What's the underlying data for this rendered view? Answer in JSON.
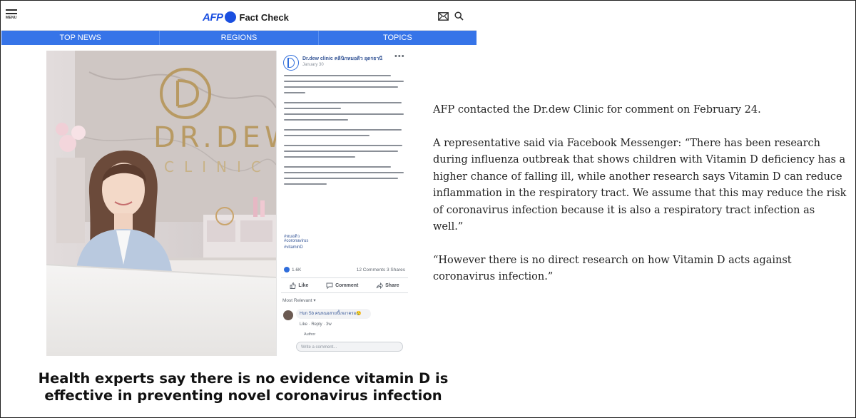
{
  "header": {
    "menu_label": "MENU",
    "brand_afp": "AFP",
    "brand_name": "Fact Check",
    "icons": [
      "mail-icon",
      "search-icon"
    ]
  },
  "nav": {
    "tabs": [
      {
        "label": "TOP NEWS"
      },
      {
        "label": "REGIONS"
      },
      {
        "label": "TOPICS"
      }
    ],
    "accent": "#3674e8"
  },
  "post": {
    "page_name": "Dr.dew clinic คลินิกหมอดิว อุดรธานี",
    "date": "January 30",
    "hashtags": [
      "#หมอดิว",
      "#coronavirus",
      "#vitaminD"
    ],
    "reactions": "1.6K",
    "counts": "12 Comments 3 Shares",
    "like_label": "Like",
    "comment_label": "Comment",
    "share_label": "Share",
    "sort_label": "Most Relevant ▾",
    "commenter": "Hun Sb คนหนอสายขี้เหงาครอ😢",
    "comment_links": "Like · Reply · 3w",
    "reply_label": "Author",
    "write_placeholder": "Write a comment..."
  },
  "photo": {
    "sign_text": "DR.DEW",
    "sign_sub": "CLINIC",
    "colors": {
      "wall": "#d9d3d4",
      "gold": "#b89a63"
    }
  },
  "article": {
    "paragraphs": [
      "AFP contacted the Dr.dew Clinic for comment on February 24.",
      "A representative said via Facebook Messenger: “There has been research during influenza outbreak that shows children with Vitamin D deficiency has a higher chance of falling ill, while another research says Vitamin D can reduce inflammation in the respiratory tract. We assume that this may reduce the risk of coronavirus infection because it is also a respiratory tract infection as well.”",
      "“However there is no direct research on how Vitamin D acts against coronavirus infection.”"
    ]
  },
  "caption": {
    "line1": "Health experts say there is no evidence vitamin D is",
    "line2": "effective in preventing novel coronavirus infection"
  }
}
